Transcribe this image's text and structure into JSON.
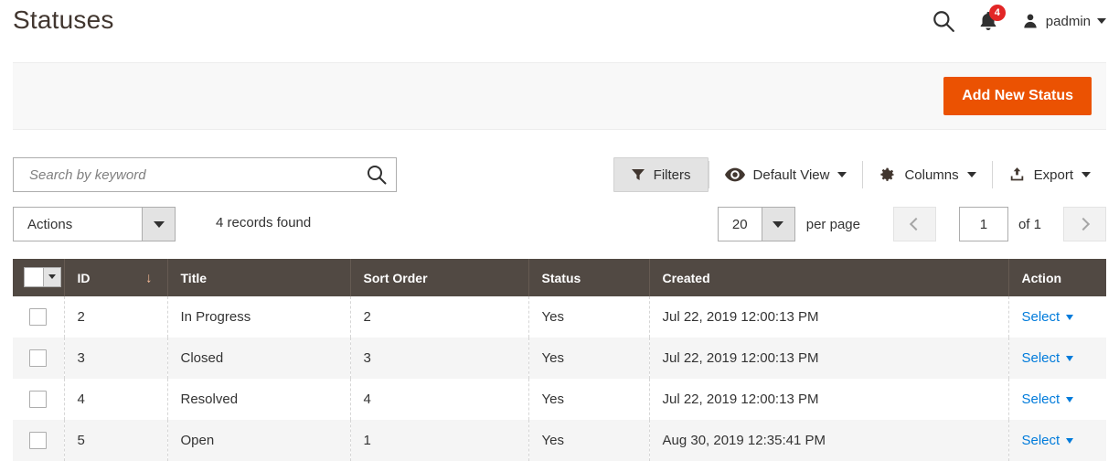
{
  "header": {
    "title": "Statuses",
    "search_icon": "search-icon",
    "notifications": {
      "icon": "bell-icon",
      "count": "4"
    },
    "user": {
      "icon": "user-icon",
      "name": "padmin",
      "caret": "caret-down-icon"
    }
  },
  "page_actions": {
    "add_new_label": "Add New Status",
    "accent_color": "#eb5202"
  },
  "toolbar": {
    "search": {
      "placeholder": "Search by keyword",
      "value": "",
      "icon": "search-icon"
    },
    "filters": {
      "label": "Filters",
      "icon": "funnel-icon"
    },
    "view": {
      "label": "Default View",
      "icon": "eye-icon"
    },
    "columns": {
      "label": "Columns",
      "icon": "gear-icon"
    },
    "export": {
      "label": "Export",
      "icon": "export-icon"
    }
  },
  "subtoolbar": {
    "actions": {
      "label": "Actions"
    },
    "records_found": "4 records found",
    "per_page": {
      "value": "20",
      "label": "per page"
    },
    "pagination": {
      "prev_icon": "chevron-left-icon",
      "next_icon": "chevron-right-icon",
      "current_page": "1",
      "total_label": "of 1"
    }
  },
  "grid": {
    "header_checkbox": {
      "icon": "checkbox-dropdown"
    },
    "columns": [
      {
        "key": "id",
        "label": "ID",
        "sorted": true,
        "sort_dir": "↓"
      },
      {
        "key": "title",
        "label": "Title"
      },
      {
        "key": "sort_order",
        "label": "Sort Order"
      },
      {
        "key": "status",
        "label": "Status"
      },
      {
        "key": "created",
        "label": "Created"
      },
      {
        "key": "action",
        "label": "Action"
      }
    ],
    "rows": [
      {
        "id": "2",
        "title": "In Progress",
        "sort_order": "2",
        "status": "Yes",
        "created": "Jul 22, 2019 12:00:13 PM",
        "action": "Select"
      },
      {
        "id": "3",
        "title": "Closed",
        "sort_order": "3",
        "status": "Yes",
        "created": "Jul 22, 2019 12:00:13 PM",
        "action": "Select"
      },
      {
        "id": "4",
        "title": "Resolved",
        "sort_order": "4",
        "status": "Yes",
        "created": "Jul 22, 2019 12:00:13 PM",
        "action": "Select"
      },
      {
        "id": "5",
        "title": "Open",
        "sort_order": "1",
        "status": "Yes",
        "created": "Aug 30, 2019 12:35:41 PM",
        "action": "Select"
      }
    ]
  }
}
